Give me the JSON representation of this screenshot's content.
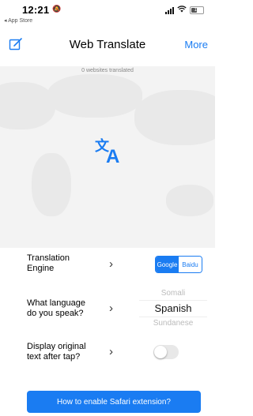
{
  "status": {
    "time": "12:21",
    "back_label": "◂ App Store",
    "battery": "10",
    "battery_level_percent": 45
  },
  "nav": {
    "title": "Web Translate",
    "more_label": "More"
  },
  "hero": {
    "count_text": "0 websites translated"
  },
  "settings": {
    "engine": {
      "label_line1": "Translation",
      "label_line2": "Engine",
      "options": [
        "Google",
        "Baidu"
      ],
      "selected": "Google"
    },
    "language": {
      "label_line1": "What language",
      "label_line2": "do you speak?",
      "prev": "Somali",
      "selected": "Spanish",
      "next": "Sundanese"
    },
    "display_original": {
      "label_line1": "Display original",
      "label_line2": "text after tap?",
      "enabled": false
    }
  },
  "cta_label": "How to enable Safari extension?",
  "colors": {
    "accent": "#1a7cf2",
    "hero_bg": "#f3f3f3"
  }
}
